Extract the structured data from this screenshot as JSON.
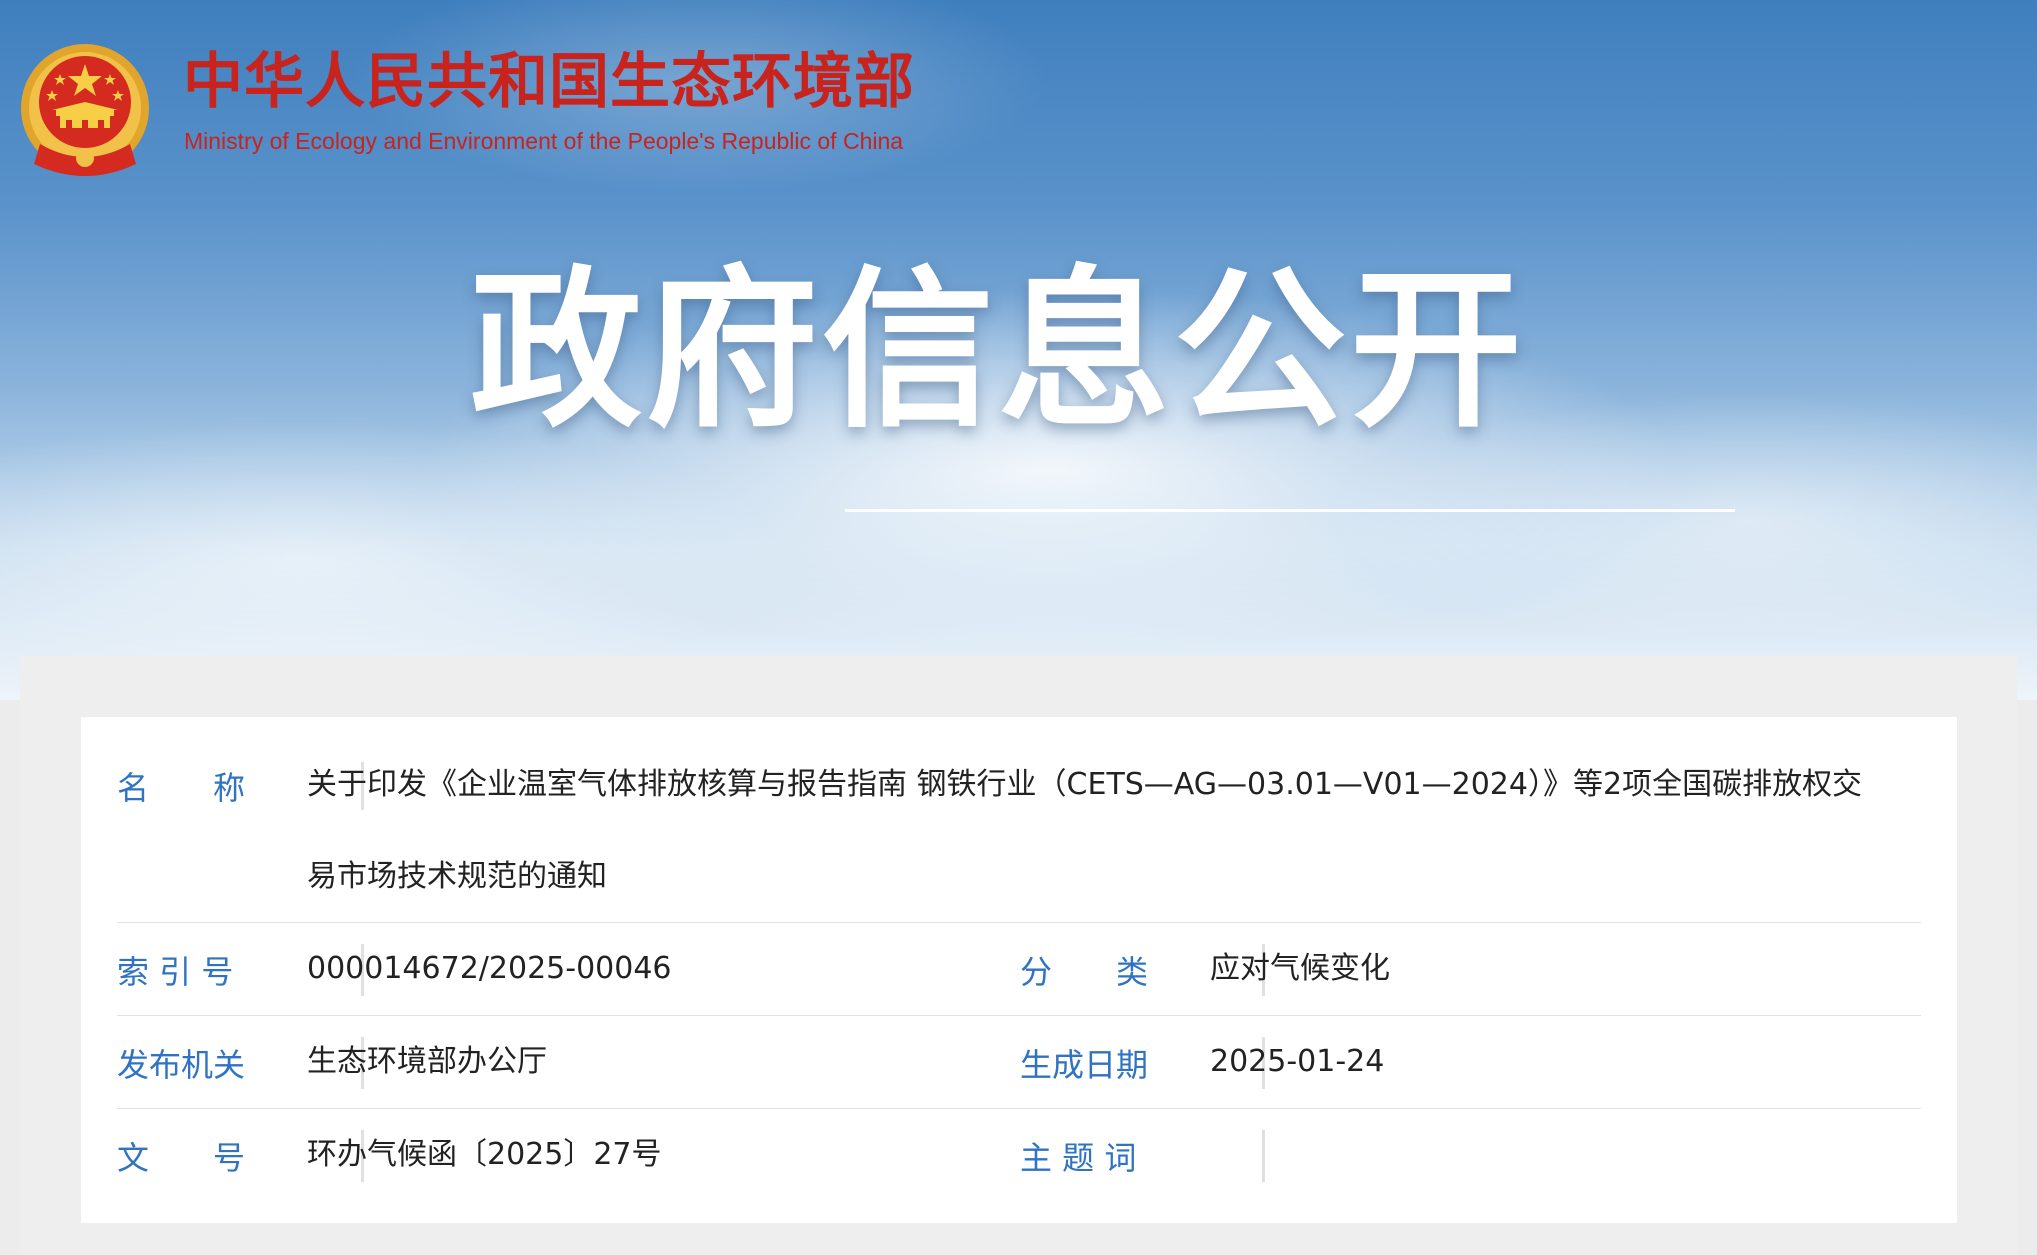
{
  "header": {
    "ministry_name_cn": "中华人民共和国生态环境部",
    "ministry_name_en": "Ministry of Ecology and Environment of the People's Republic of China",
    "section_title": "政府信息公开",
    "emblem_icon": "national-emblem-icon"
  },
  "colors": {
    "ministry_red": "#c8231c",
    "label_blue": "#2f73c2",
    "banner_sky_blue": "#3f7fbe"
  },
  "info": {
    "name_label": "名　　称",
    "name_value": "关于印发《企业温室气体排放核算与报告指南 钢铁行业（CETS—AG—03.01—V01—2024）》等2项全国碳排放权交易市场技术规范的通知",
    "index_label": "索 引 号",
    "index_value": "000014672/2025-00046",
    "category_label": "分　　类",
    "category_value": "应对气候变化",
    "publisher_label": "发布机关",
    "publisher_value": "生态环境部办公厅",
    "date_label": "生成日期",
    "date_value": "2025-01-24",
    "doc_number_label": "文　　号",
    "doc_number_value": "环办气候函〔2025〕27号",
    "keywords_label": "主 题 词",
    "keywords_value": ""
  }
}
